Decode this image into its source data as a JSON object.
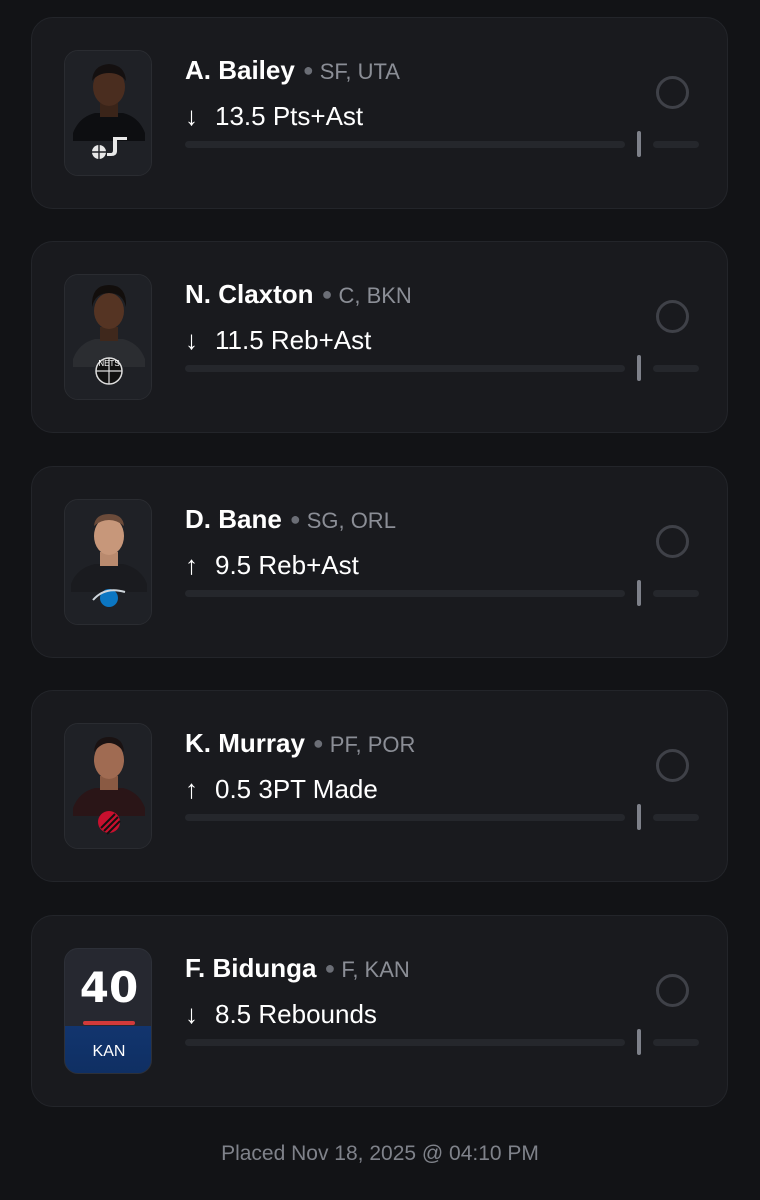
{
  "picks": [
    {
      "name": "A. Bailey",
      "position_team": "SF, UTA",
      "direction": "down",
      "arrow": "↓",
      "line": "13.5 Pts+Ast",
      "team_logo": "jazz-note-icon"
    },
    {
      "name": "N. Claxton",
      "position_team": "C, BKN",
      "direction": "down",
      "arrow": "↓",
      "line": "11.5 Reb+Ast",
      "team_logo": "nets-ball-icon"
    },
    {
      "name": "D. Bane",
      "position_team": "SG, ORL",
      "direction": "up",
      "arrow": "↑",
      "line": "9.5 Reb+Ast",
      "team_logo": "magic-ball-icon"
    },
    {
      "name": "K. Murray",
      "position_team": "PF, POR",
      "direction": "up",
      "arrow": "↑",
      "line": "0.5 3PT Made",
      "team_logo": "blazers-pinwheel-icon"
    },
    {
      "name": "F. Bidunga",
      "position_team": "F, KAN",
      "direction": "down",
      "arrow": "↓",
      "line": "8.5 Rebounds",
      "jersey_number": "40",
      "jersey_team": "KAN"
    }
  ],
  "footer": {
    "placed_text": "Placed Nov 18, 2025 @ 04:10 PM"
  },
  "colors": {
    "background": "#121316",
    "card": "#191a1e",
    "muted_text": "#8b8e96",
    "jersey_blue": "#12356e",
    "jersey_red": "#d23a3a"
  }
}
